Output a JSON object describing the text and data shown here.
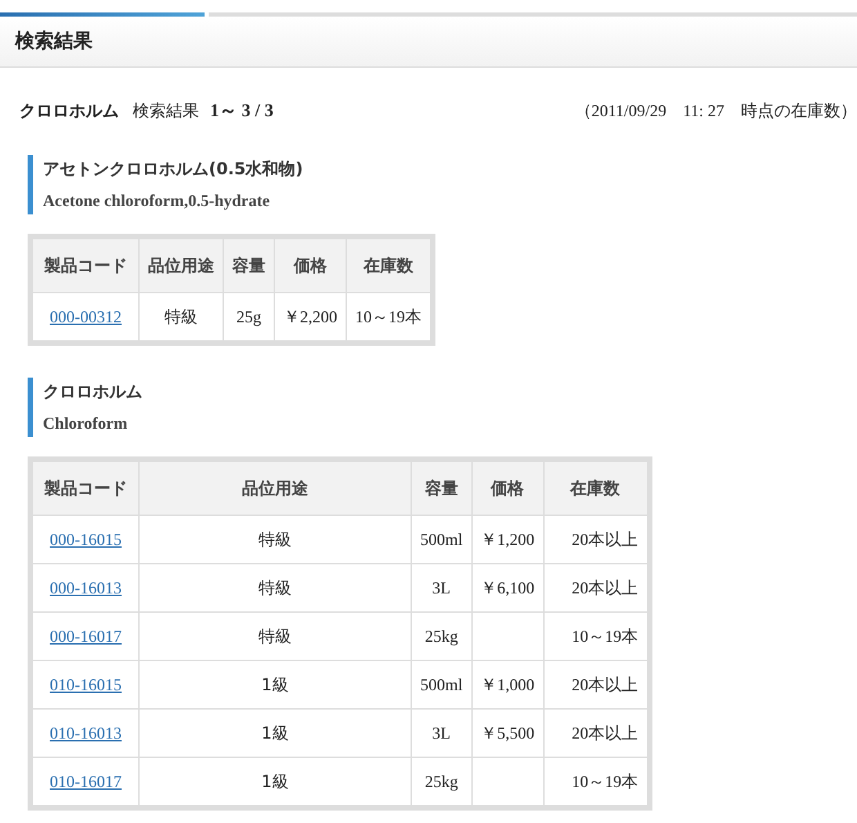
{
  "page_title": "検索結果",
  "summary": {
    "query": "クロロホルム",
    "label": "検索結果",
    "range": "1～ 3 / 3",
    "timestamp": "（2011/09/29　11: 27　時点の在庫数）"
  },
  "sections": [
    {
      "name_ja": "アセトンクロロホルム(0.5水和物)",
      "name_en": "Acetone chloroform,0.5-hydrate",
      "table": {
        "columns": [
          "製品コード",
          "品位用途",
          "容量",
          "価格",
          "在庫数"
        ],
        "rows": [
          {
            "code": "000-00312",
            "grade": "特級",
            "size": "25g",
            "price": "￥2,200",
            "stock": "10～19本"
          }
        ]
      }
    },
    {
      "name_ja": "クロロホルム",
      "name_en": "Chloroform",
      "table": {
        "columns": [
          "製品コード",
          "品位用途",
          "容量",
          "価格",
          "在庫数"
        ],
        "rows": [
          {
            "code": "000-16015",
            "grade": "特級",
            "size": "500ml",
            "price": "￥1,200",
            "stock": "20本以上"
          },
          {
            "code": "000-16013",
            "grade": "特級",
            "size": "3L",
            "price": "￥6,100",
            "stock": "20本以上"
          },
          {
            "code": "000-16017",
            "grade": "特級",
            "size": "25kg",
            "price": "",
            "stock": "10～19本"
          },
          {
            "code": "010-16015",
            "grade": "1級",
            "size": "500ml",
            "price": "￥1,000",
            "stock": "20本以上"
          },
          {
            "code": "010-16013",
            "grade": "1級",
            "size": "3L",
            "price": "￥5,500",
            "stock": "20本以上"
          },
          {
            "code": "010-16017",
            "grade": "1級",
            "size": "25kg",
            "price": "",
            "stock": "10～19本"
          }
        ]
      }
    }
  ]
}
